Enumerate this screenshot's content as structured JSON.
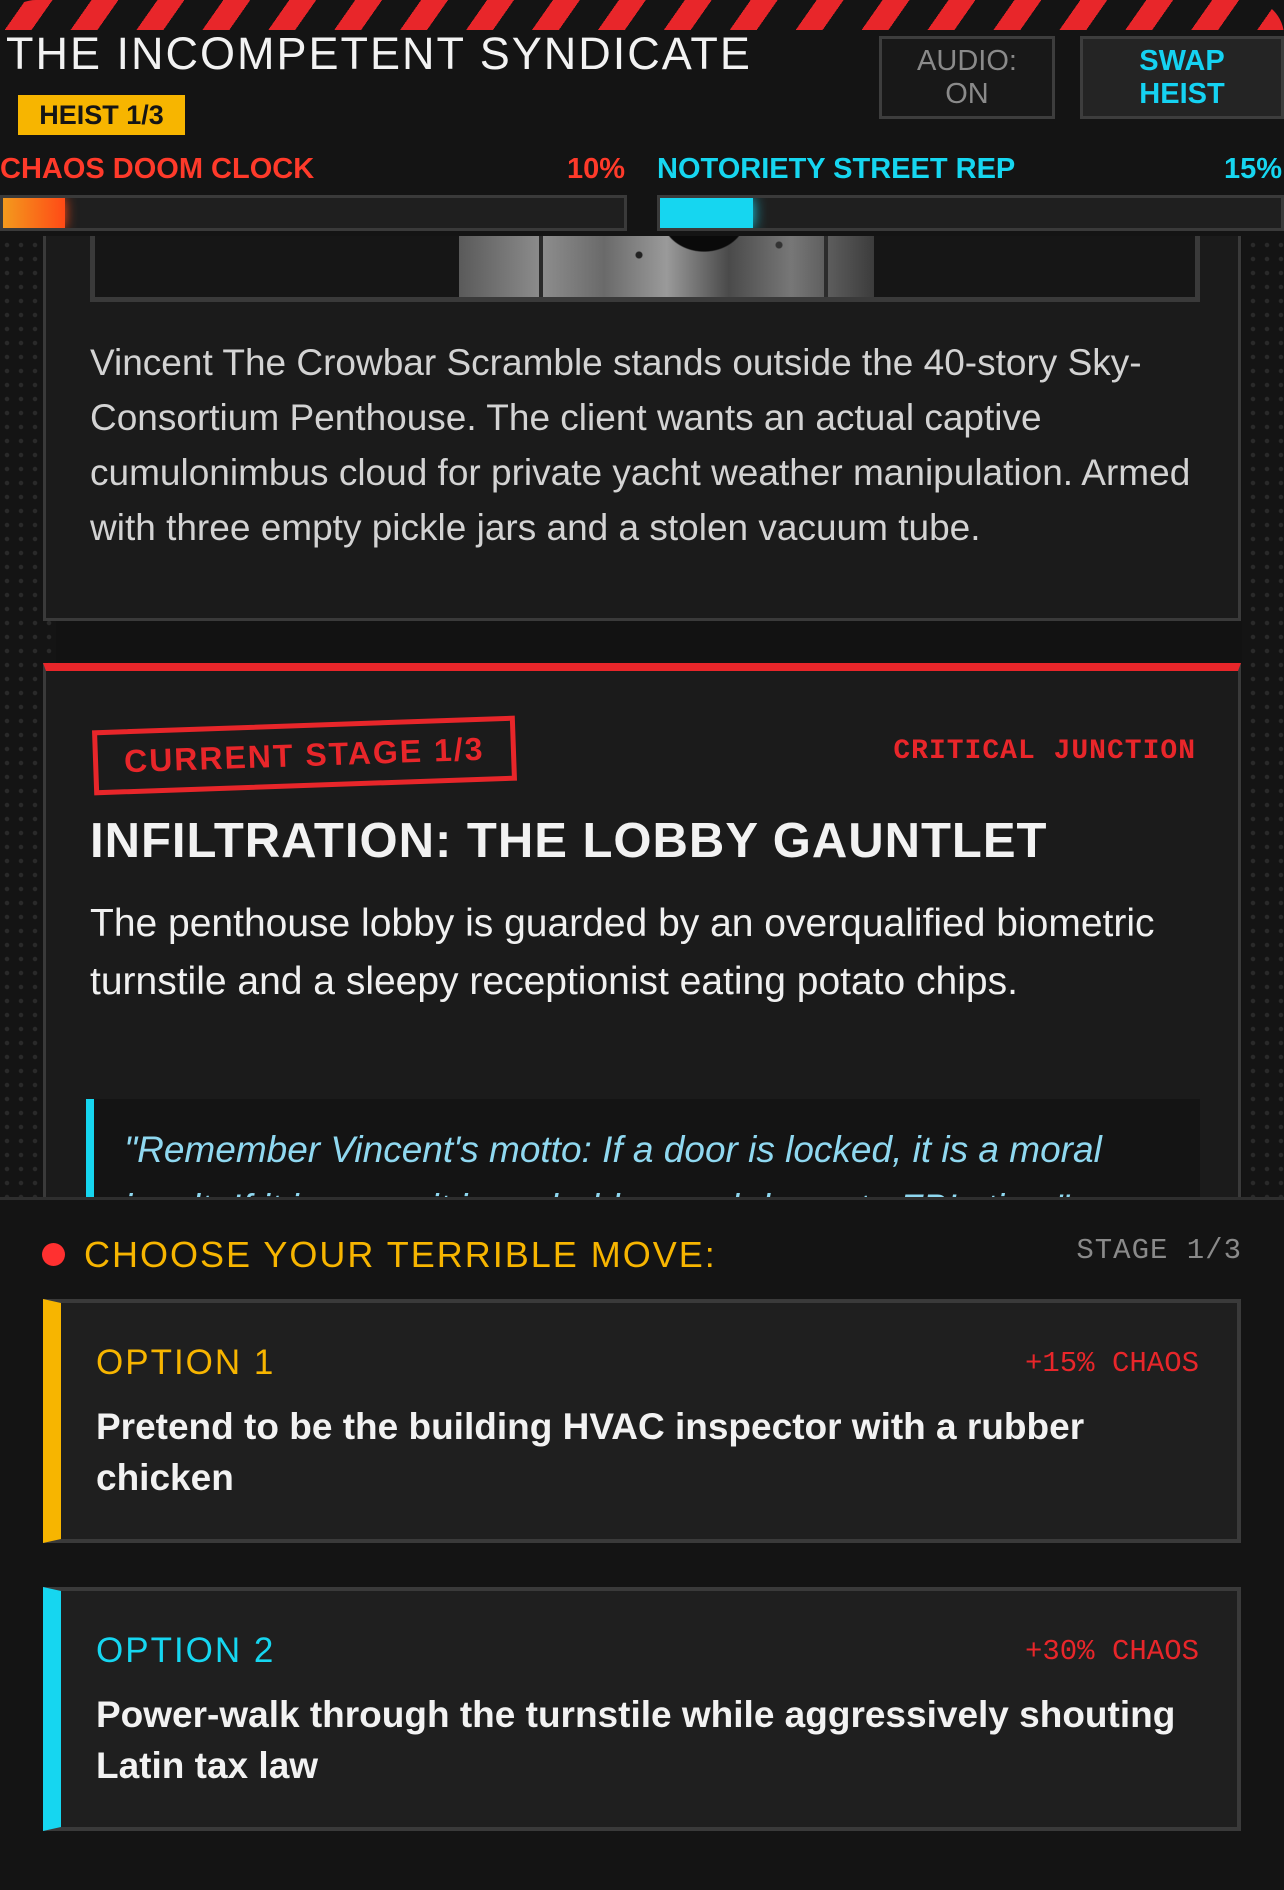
{
  "header": {
    "title": "THE INCOMPETENT SYNDICATE",
    "heist_badge": "HEIST 1/3",
    "audio_button": "AUDIO: ON",
    "swap_button": "SWAP HEIST"
  },
  "meters": {
    "chaos": {
      "label": "CHAOS DOOM CLOCK",
      "value_text": "10%",
      "fraction": 0.1,
      "color": "#ff4a16"
    },
    "notoriety": {
      "label": "NOTORIETY STREET REP",
      "value_text": "15%",
      "fraction": 0.15,
      "color": "#16d6f0"
    }
  },
  "intro": {
    "text": "Vincent The Crowbar Scramble stands outside the 40-story Sky-Consortium Penthouse. The client wants an actual captive cumulonimbus cloud for private yacht weather manipulation. Armed with three empty pickle jars and a stolen vacuum tube."
  },
  "stage": {
    "badge": "CURRENT STAGE 1/3",
    "tag": "CRITICAL JUNCTION",
    "title": "INFILTRATION: THE LOBBY GAUNTLET",
    "description": "The penthouse lobby is guarded by an overqualified biometric turnstile and a sleepy receptionist eating potato chips.",
    "quote": "\"Remember Vincent's motto: If a door is locked, it is a moral insult. If it is open, it is probably a sad decoy to FBI sting.\""
  },
  "choices": {
    "prompt": "CHOOSE YOUR TERRIBLE MOVE:",
    "stage_indicator": "STAGE 1/3",
    "options": [
      {
        "label": "OPTION 1",
        "effect": "+15% CHAOS",
        "text": "Pretend to be the building HVAC inspector with a rubber chicken",
        "accent": "#f7b500"
      },
      {
        "label": "OPTION 2",
        "effect": "+30% CHAOS",
        "text": "Power-walk through the turnstile while aggressively shouting Latin tax law",
        "accent": "#16d6f0"
      }
    ]
  },
  "colors": {
    "danger": "#e8262a",
    "warning": "#f7b500",
    "info": "#16d6f0"
  }
}
